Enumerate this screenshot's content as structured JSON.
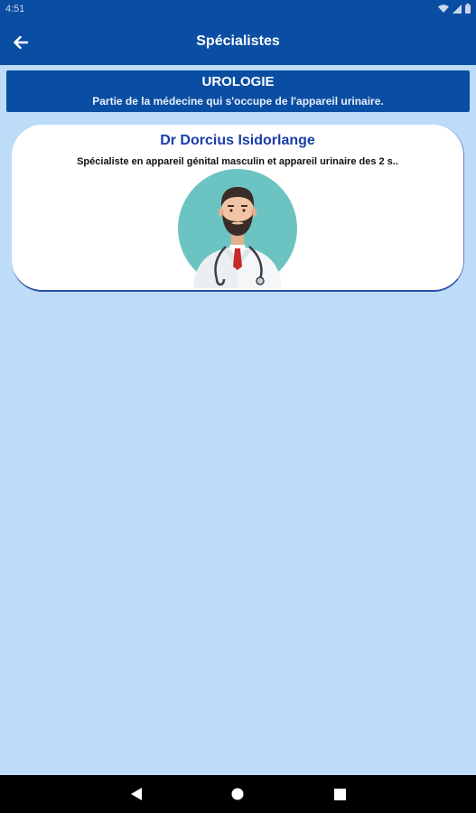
{
  "status_bar": {
    "time": "4:51",
    "icons": [
      "wifi-icon",
      "signal-icon",
      "battery-icon"
    ]
  },
  "app_bar": {
    "title": "Spécialistes",
    "back_icon": "arrow-left-icon"
  },
  "category": {
    "name": "UROLOGIE",
    "description": "Partie de la médecine qui s'occupe de l'appareil urinaire."
  },
  "doctors": [
    {
      "name": "Dr Dorcius Isidorlange",
      "description": "Spécialiste en appareil génital masculin et appareil urinaire des 2 s..",
      "avatar": "doctor-avatar"
    }
  ],
  "nav_bar": {
    "icons": [
      "back-triangle-icon",
      "home-circle-icon",
      "recents-square-icon"
    ]
  },
  "colors": {
    "primary": "#0a4ea3",
    "background": "#bcdcf8",
    "card": "#ffffff",
    "doctor_name": "#1a3da6",
    "avatar_bg": "#6cc4c2"
  }
}
